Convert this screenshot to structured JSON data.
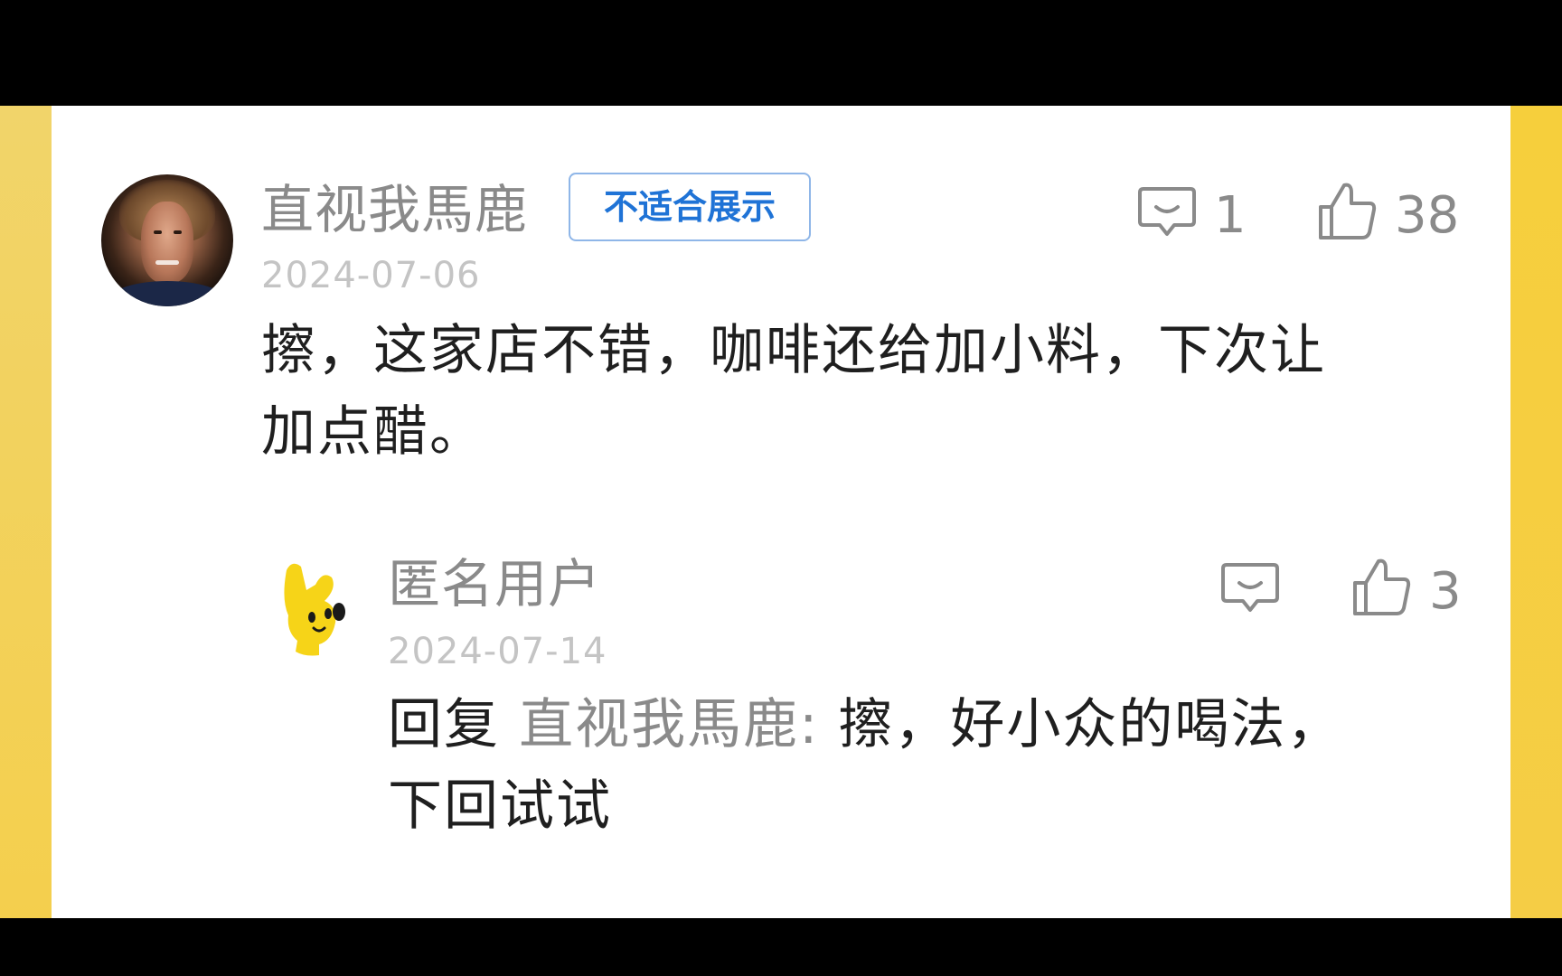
{
  "comment": {
    "author": "直视我馬鹿",
    "badge": "不适合展示",
    "date": "2024-07-06",
    "text_line1": "擦，这家店不错，咖啡还给加小料，下次让",
    "text_line2": "加点醋。",
    "reply_count": "1",
    "like_count": "38"
  },
  "reply": {
    "author": "匿名用户",
    "date": "2024-07-14",
    "prefix": "回复",
    "target": "直视我馬鹿:",
    "text_line1": "擦，好小众的喝法，",
    "text_line2": "下回试试",
    "reply_count": "",
    "like_count": "3"
  },
  "colors": {
    "background_frame": "#000000",
    "side_panel": "#f5cc3f",
    "card": "#ffffff",
    "badge_text": "#1f73d6",
    "badge_border": "#8fb6e8",
    "muted_text": "#8a8a8a"
  },
  "icons": [
    "comment-bubble-icon",
    "thumbs-up-icon"
  ]
}
